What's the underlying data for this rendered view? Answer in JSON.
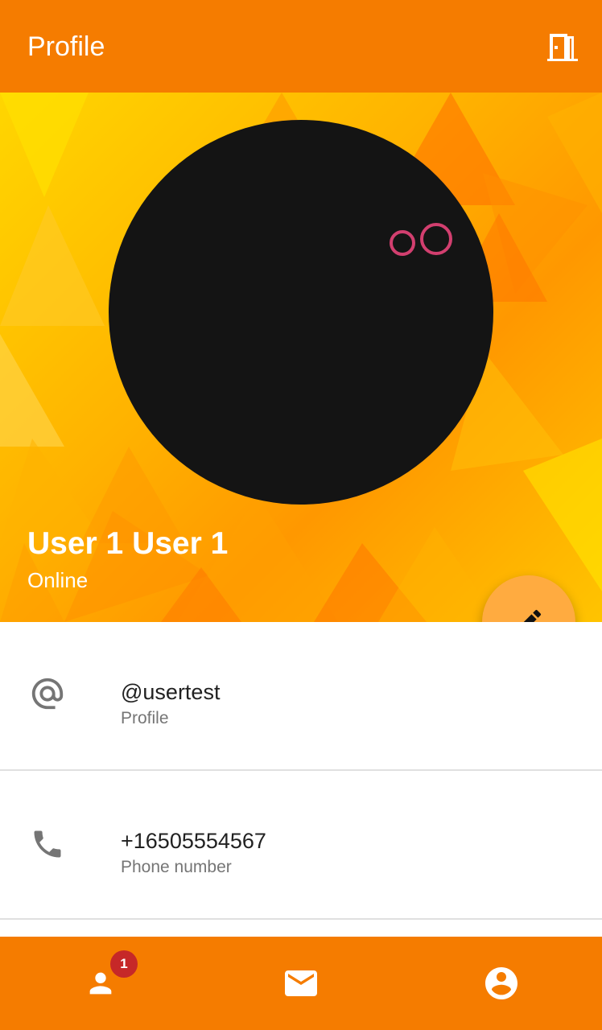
{
  "appbar": {
    "title": "Profile",
    "exit_icon": "exit-door-icon"
  },
  "profile": {
    "name": "User 1 User 1",
    "status": "Online"
  },
  "info": [
    {
      "icon": "at-sign-icon",
      "value": "@usertest",
      "label": "Profile"
    },
    {
      "icon": "phone-icon",
      "value": "+16505554567",
      "label": "Phone number"
    }
  ],
  "bottom_nav": {
    "contacts_badge": "1",
    "items": [
      "contacts-icon",
      "mail-icon",
      "account-circle-icon"
    ]
  },
  "colors": {
    "primary": "#f57c00",
    "fab": "#ffab40",
    "badge": "#c62828",
    "avatar_rings": "#d23f6f"
  }
}
